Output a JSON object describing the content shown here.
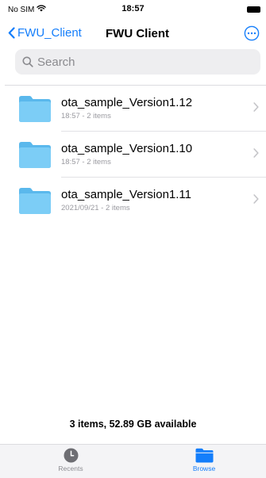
{
  "status_bar": {
    "carrier": "No SIM",
    "time": "18:57"
  },
  "nav": {
    "back_label": "FWU_Client",
    "title": "FWU Client"
  },
  "search": {
    "placeholder": "Search"
  },
  "items": [
    {
      "name": "ota_sample_Version1.12",
      "subtitle": "18:57 - 2 items"
    },
    {
      "name": "ota_sample_Version1.10",
      "subtitle": "18:57 - 2 items"
    },
    {
      "name": "ota_sample_Version1.11",
      "subtitle": "2021/09/21 - 2 items"
    }
  ],
  "summary": "3 items, 52.89 GB available",
  "tabs": {
    "recents_label": "Recents",
    "browse_label": "Browse"
  },
  "colors": {
    "accent": "#147efb",
    "folder": "#6cc6f4"
  },
  "icons": [
    "wifi-icon",
    "battery-icon",
    "chevron-left-icon",
    "more-icon",
    "search-icon",
    "folder-icon",
    "chevron-right-icon",
    "clock-icon"
  ]
}
